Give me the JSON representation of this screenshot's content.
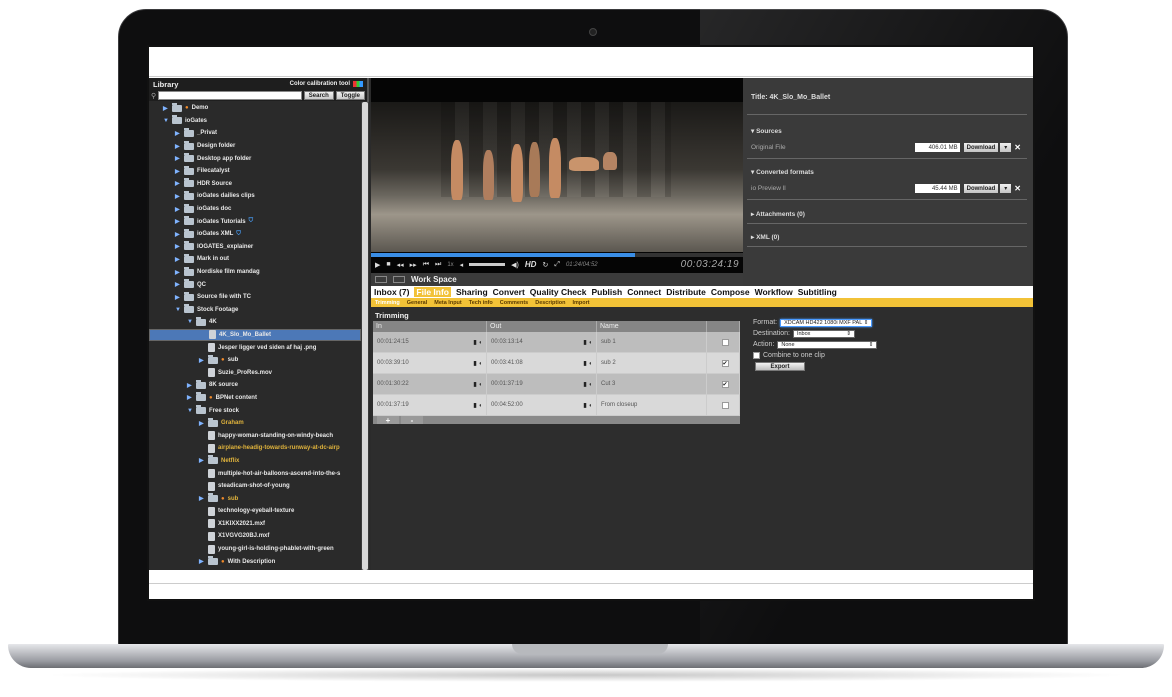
{
  "library": {
    "title": "Library",
    "calibration_label": "Color calibration tool",
    "search_placeholder": "",
    "search_button": "Search",
    "toggle_button": "Toggle",
    "tree": [
      {
        "label": "Demo",
        "depth": 0,
        "type": "folder",
        "expanded": false,
        "dot": true
      },
      {
        "label": "ioGates",
        "depth": 0,
        "type": "folder",
        "expanded": true
      },
      {
        "label": "_Privat",
        "depth": 1,
        "type": "folder"
      },
      {
        "label": "Design folder",
        "depth": 1,
        "type": "folder"
      },
      {
        "label": "Desktop app folder",
        "depth": 1,
        "type": "folder"
      },
      {
        "label": "Filecatalyst",
        "depth": 1,
        "type": "folder"
      },
      {
        "label": "HDR Source",
        "depth": 1,
        "type": "folder"
      },
      {
        "label": "ioGates dailies clips",
        "depth": 1,
        "type": "folder"
      },
      {
        "label": "ioGates doc",
        "depth": 1,
        "type": "folder"
      },
      {
        "label": "ioGates Tutorials",
        "depth": 1,
        "type": "folder",
        "shield": true
      },
      {
        "label": "ioGates XML",
        "depth": 1,
        "type": "folder",
        "shield": true
      },
      {
        "label": "IOGATES_explainer",
        "depth": 1,
        "type": "folder"
      },
      {
        "label": "Mark in out",
        "depth": 1,
        "type": "folder"
      },
      {
        "label": "Nordiske film mandag",
        "depth": 1,
        "type": "folder"
      },
      {
        "label": "QC",
        "depth": 1,
        "type": "folder"
      },
      {
        "label": "Source file with TC",
        "depth": 1,
        "type": "folder"
      },
      {
        "label": "Stock Footage",
        "depth": 1,
        "type": "folder",
        "expanded": true
      },
      {
        "label": "4K",
        "depth": 2,
        "type": "folder",
        "expanded": true
      },
      {
        "label": "4K_Slo_Mo_Ballet",
        "depth": 3,
        "type": "file",
        "selected": true
      },
      {
        "label": "Jesper ligger ved siden af haj .png",
        "depth": 3,
        "type": "file"
      },
      {
        "label": "sub",
        "depth": 3,
        "type": "folder",
        "dot": true
      },
      {
        "label": "Suzie_ProRes.mov",
        "depth": 3,
        "type": "file"
      },
      {
        "label": "8K source",
        "depth": 2,
        "type": "folder"
      },
      {
        "label": "BPNet content",
        "depth": 2,
        "type": "folder",
        "dot": true
      },
      {
        "label": "Free stock",
        "depth": 2,
        "type": "folder",
        "expanded": true
      },
      {
        "label": "Graham",
        "depth": 3,
        "type": "folder",
        "yellow": true
      },
      {
        "label": "happy-woman-standing-on-windy-beach",
        "depth": 3,
        "type": "file"
      },
      {
        "label": "airplane-headig-towards-runway-at-dc-airp",
        "depth": 3,
        "type": "file",
        "yellow": true
      },
      {
        "label": "Netflix",
        "depth": 3,
        "type": "folder",
        "yellow": true
      },
      {
        "label": "multiple-hot-air-balloons-ascend-into-the-s",
        "depth": 3,
        "type": "file"
      },
      {
        "label": "steadicam-shot-of-young",
        "depth": 3,
        "type": "file"
      },
      {
        "label": "sub",
        "depth": 3,
        "type": "folder",
        "dot": true,
        "yellow": true
      },
      {
        "label": "technology-eyeball-texture",
        "depth": 3,
        "type": "file"
      },
      {
        "label": "X1KIXX2021.mxf",
        "depth": 3,
        "type": "file"
      },
      {
        "label": "X1VGVG20BJ.mxf",
        "depth": 3,
        "type": "file"
      },
      {
        "label": "young-girl-is-holding-phablet-with-green",
        "depth": 3,
        "type": "file"
      },
      {
        "label": "With Description",
        "depth": 3,
        "type": "folder",
        "dot": true
      }
    ]
  },
  "player": {
    "progress_fraction": 0.71,
    "hd_label": "HD",
    "small_timecode": "01:24/04:52",
    "timecode": "00:03:24:19",
    "speed_label": "1x"
  },
  "workspace_label": "Work Space",
  "info": {
    "title": "Title:  4K_Slo_Mo_Ballet",
    "sources_label": "Sources",
    "original_file_label": "Original File",
    "original_size": "406.01 MB",
    "download_label": "Download",
    "converted_label": "Converted formats",
    "preview_label": "io Preview ll",
    "preview_size": "45.44 MB",
    "attachments_label": "Attachments (0)",
    "xml_label": "XML (0)"
  },
  "tabs": [
    "Inbox (7)",
    "File Info",
    "Sharing",
    "Convert",
    "Quality Check",
    "Publish",
    "Connect",
    "Distribute",
    "Compose",
    "Workflow",
    "Subtitling"
  ],
  "active_tab": 1,
  "subtabs": [
    "Trimming",
    "General",
    "Meta Input",
    "Tech info",
    "Comments",
    "Description",
    "Import"
  ],
  "trimming": {
    "label": "Trimming",
    "headers": [
      "In",
      "Out",
      "Name"
    ],
    "rows": [
      {
        "in": "00:01:24:15",
        "out": "00:03:13:14",
        "name": "sub 1",
        "checked": false
      },
      {
        "in": "00:03:39:10",
        "out": "00:03:41:08",
        "name": "sub 2",
        "checked": true
      },
      {
        "in": "00:01:30:22",
        "out": "00:01:37:19",
        "name": "Cut 3",
        "checked": true
      },
      {
        "in": "00:01:37:19",
        "out": "00:04:52:00",
        "name": "From closeup",
        "checked": false
      }
    ],
    "add_label": "+",
    "remove_label": "-"
  },
  "export_form": {
    "format_label": "Format:",
    "format_value": "XDCAM HD422 1080i MXF PAL",
    "destination_label": "Destination:",
    "destination_value": "Inbox",
    "action_label": "Action:",
    "action_value": "None",
    "combine_label": "Combine to one clip",
    "export_button": "Export"
  },
  "colors": {
    "accent_yellow": "#f2c237",
    "selection_blue": "#4c78b7",
    "progress_blue": "#3a8ee6"
  }
}
